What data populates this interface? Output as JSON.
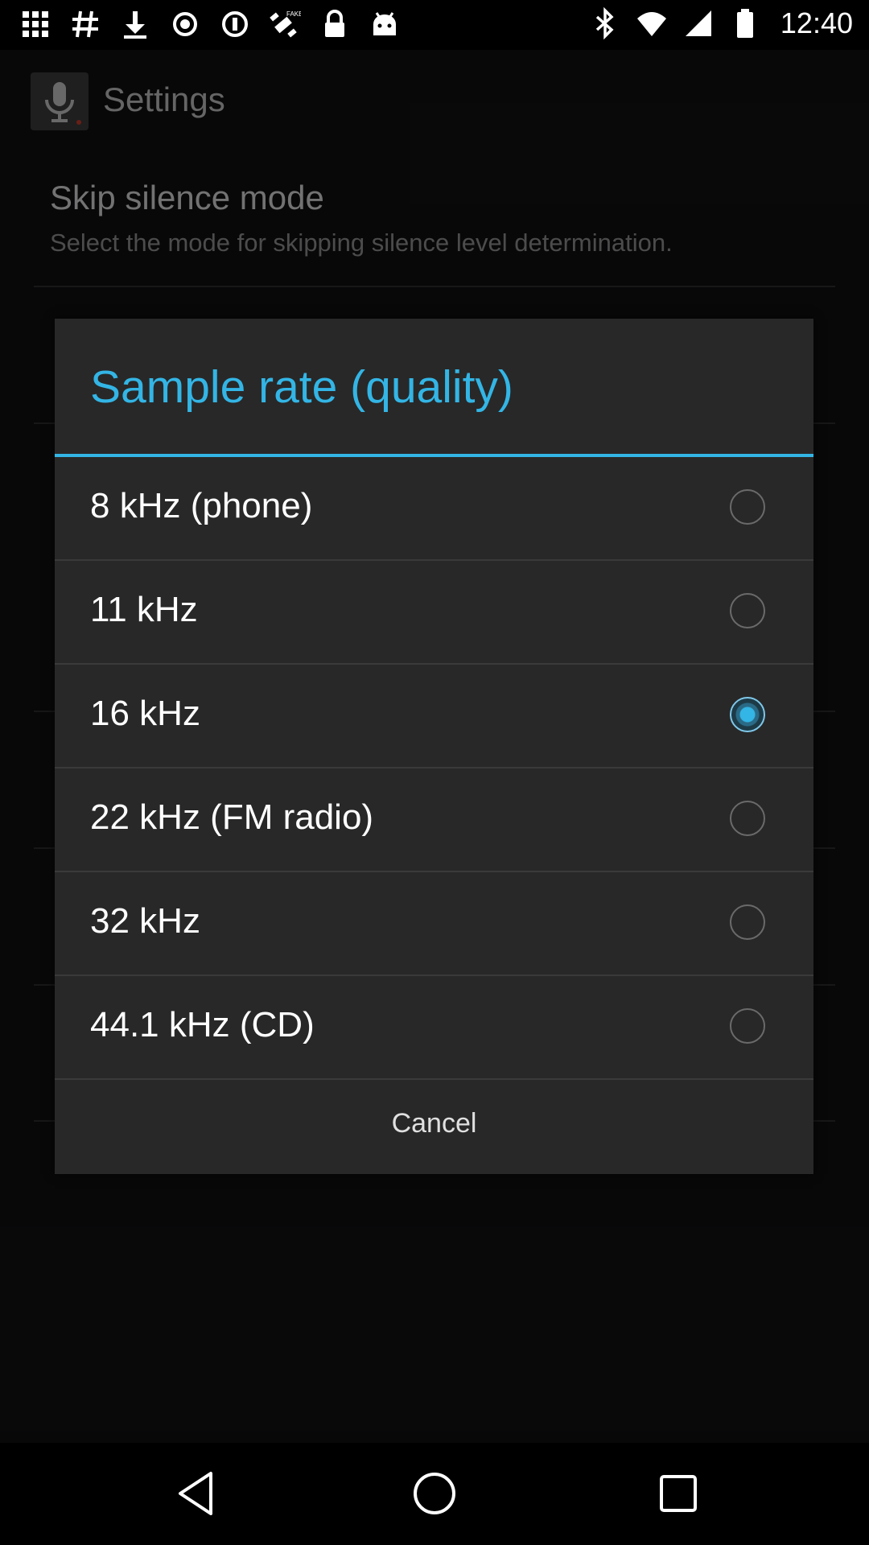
{
  "status_bar": {
    "time": "12:40",
    "left_icons": [
      "grid-icon",
      "hashtag-icon",
      "download-icon",
      "record-icon",
      "radio-icon",
      "fake-gps-icon",
      "lock-icon",
      "android-icon"
    ],
    "right_icons": [
      "bluetooth-icon",
      "wifi-icon",
      "signal-icon",
      "battery-icon"
    ]
  },
  "app": {
    "title": "Settings",
    "setting": {
      "title": "Skip silence mode",
      "subtitle": "Select the mode for skipping silence level determination."
    }
  },
  "dialog": {
    "title": "Sample rate (quality)",
    "options": [
      {
        "label": "8 kHz (phone)",
        "selected": false
      },
      {
        "label": "11 kHz",
        "selected": false
      },
      {
        "label": "16 kHz",
        "selected": true
      },
      {
        "label": "22 kHz (FM radio)",
        "selected": false
      },
      {
        "label": "32 kHz",
        "selected": false
      },
      {
        "label": "44.1 kHz (CD)",
        "selected": false
      }
    ],
    "cancel_label": "Cancel"
  },
  "colors": {
    "accent": "#33b5e5",
    "dialog_bg": "#282828"
  }
}
